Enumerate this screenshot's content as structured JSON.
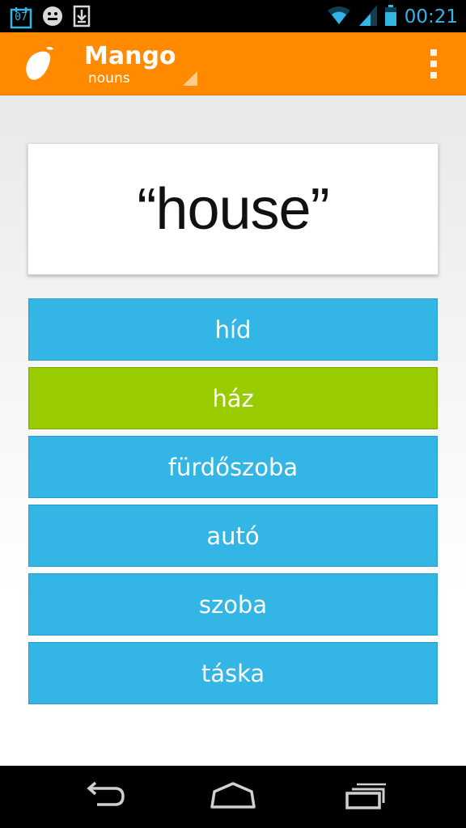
{
  "status_bar": {
    "date_badge": "07",
    "time": "00:21",
    "icons": [
      "calendar-icon",
      "smiley-icon",
      "download-icon",
      "wifi-icon",
      "signal-icon",
      "battery-icon"
    ]
  },
  "action_bar": {
    "title": "Mango",
    "subtitle": "nouns",
    "logo": "mango-logo-icon",
    "menu_icon": "overflow-menu-icon"
  },
  "quiz": {
    "prompt_word": "“house”",
    "answers": [
      {
        "label": "híd",
        "state": "default"
      },
      {
        "label": "ház",
        "state": "correct"
      },
      {
        "label": "fürdőszoba",
        "state": "default"
      },
      {
        "label": "autó",
        "state": "default"
      },
      {
        "label": "szoba",
        "state": "default"
      },
      {
        "label": "táska",
        "state": "default"
      }
    ]
  },
  "nav_bar": {
    "icons": [
      "back-icon",
      "home-icon",
      "recent-apps-icon"
    ]
  },
  "colors": {
    "action_bar": "#ff8a00",
    "answer_default": "#33b5e5",
    "answer_correct": "#99cc00",
    "status_accent": "#33b5e5"
  }
}
